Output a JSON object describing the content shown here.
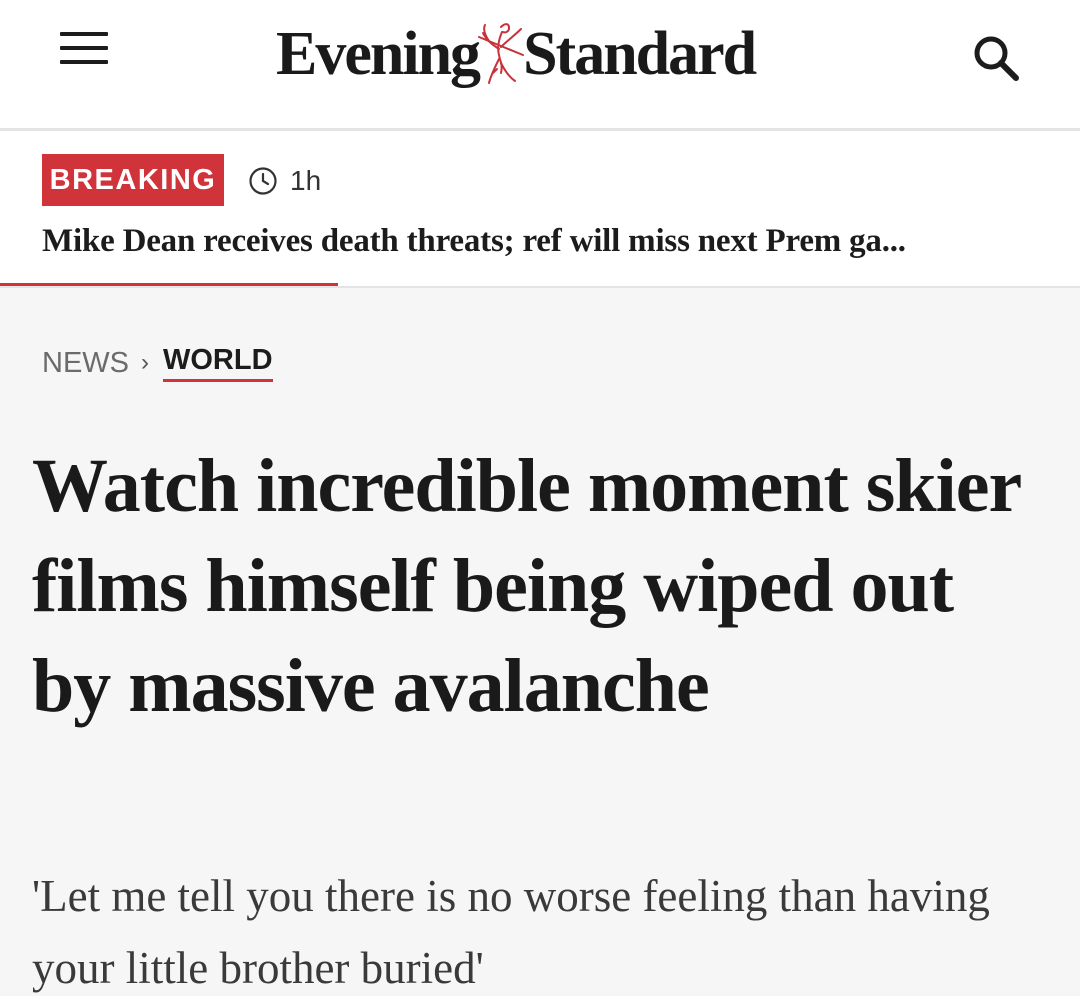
{
  "header": {
    "logo_left": "Evening",
    "logo_right": "Standard",
    "menu_icon": "hamburger-menu-icon",
    "search_icon": "search-icon"
  },
  "breaking": {
    "badge": "BREAKING",
    "time": "1h",
    "headline": "Mike Dean receives death threats; ref will miss next Prem ga..."
  },
  "breadcrumb": {
    "section": "NEWS",
    "separator": "›",
    "subsection": "WORLD"
  },
  "article": {
    "title": "Watch incredible moment skier films himself being wiped out by massive avalanche",
    "standfirst": "'Let me tell you there is no worse feeling than having your little brother buried'"
  },
  "colors": {
    "accent_red": "#d0333a",
    "text_dark": "#1c1c1c",
    "article_bg": "#f6f6f6"
  }
}
